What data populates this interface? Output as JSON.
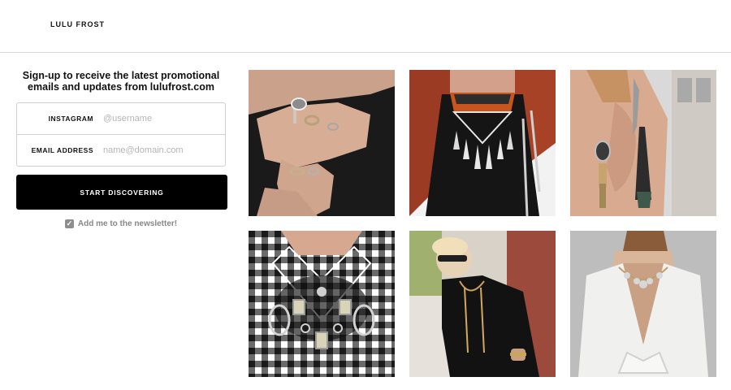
{
  "header": {
    "brand": "LULU FROST"
  },
  "signup": {
    "headline": "Sign-up to receive the latest promotional emails and updates from lulufrost.com",
    "instagram_label": "INSTAGRAM",
    "instagram_placeholder": "@username",
    "email_label": "EMAIL ADDRESS",
    "email_placeholder": "name@domain.com",
    "cta_label": "START DISCOVERING",
    "newsletter_label": "Add me to the newsletter!",
    "newsletter_checked": true
  },
  "gallery": {
    "items": [
      {
        "subject": "hands-with-rings"
      },
      {
        "subject": "statement-necklace-red-hair"
      },
      {
        "subject": "earring-and-ear-cuff"
      },
      {
        "subject": "gingham-shirt-jeweled-collar"
      },
      {
        "subject": "woman-with-sunglasses-layered-necklaces"
      },
      {
        "subject": "open-back-necklace"
      }
    ]
  },
  "colors": {
    "primary": "#000000",
    "border": "#d0d0d0",
    "muted": "#888888"
  }
}
